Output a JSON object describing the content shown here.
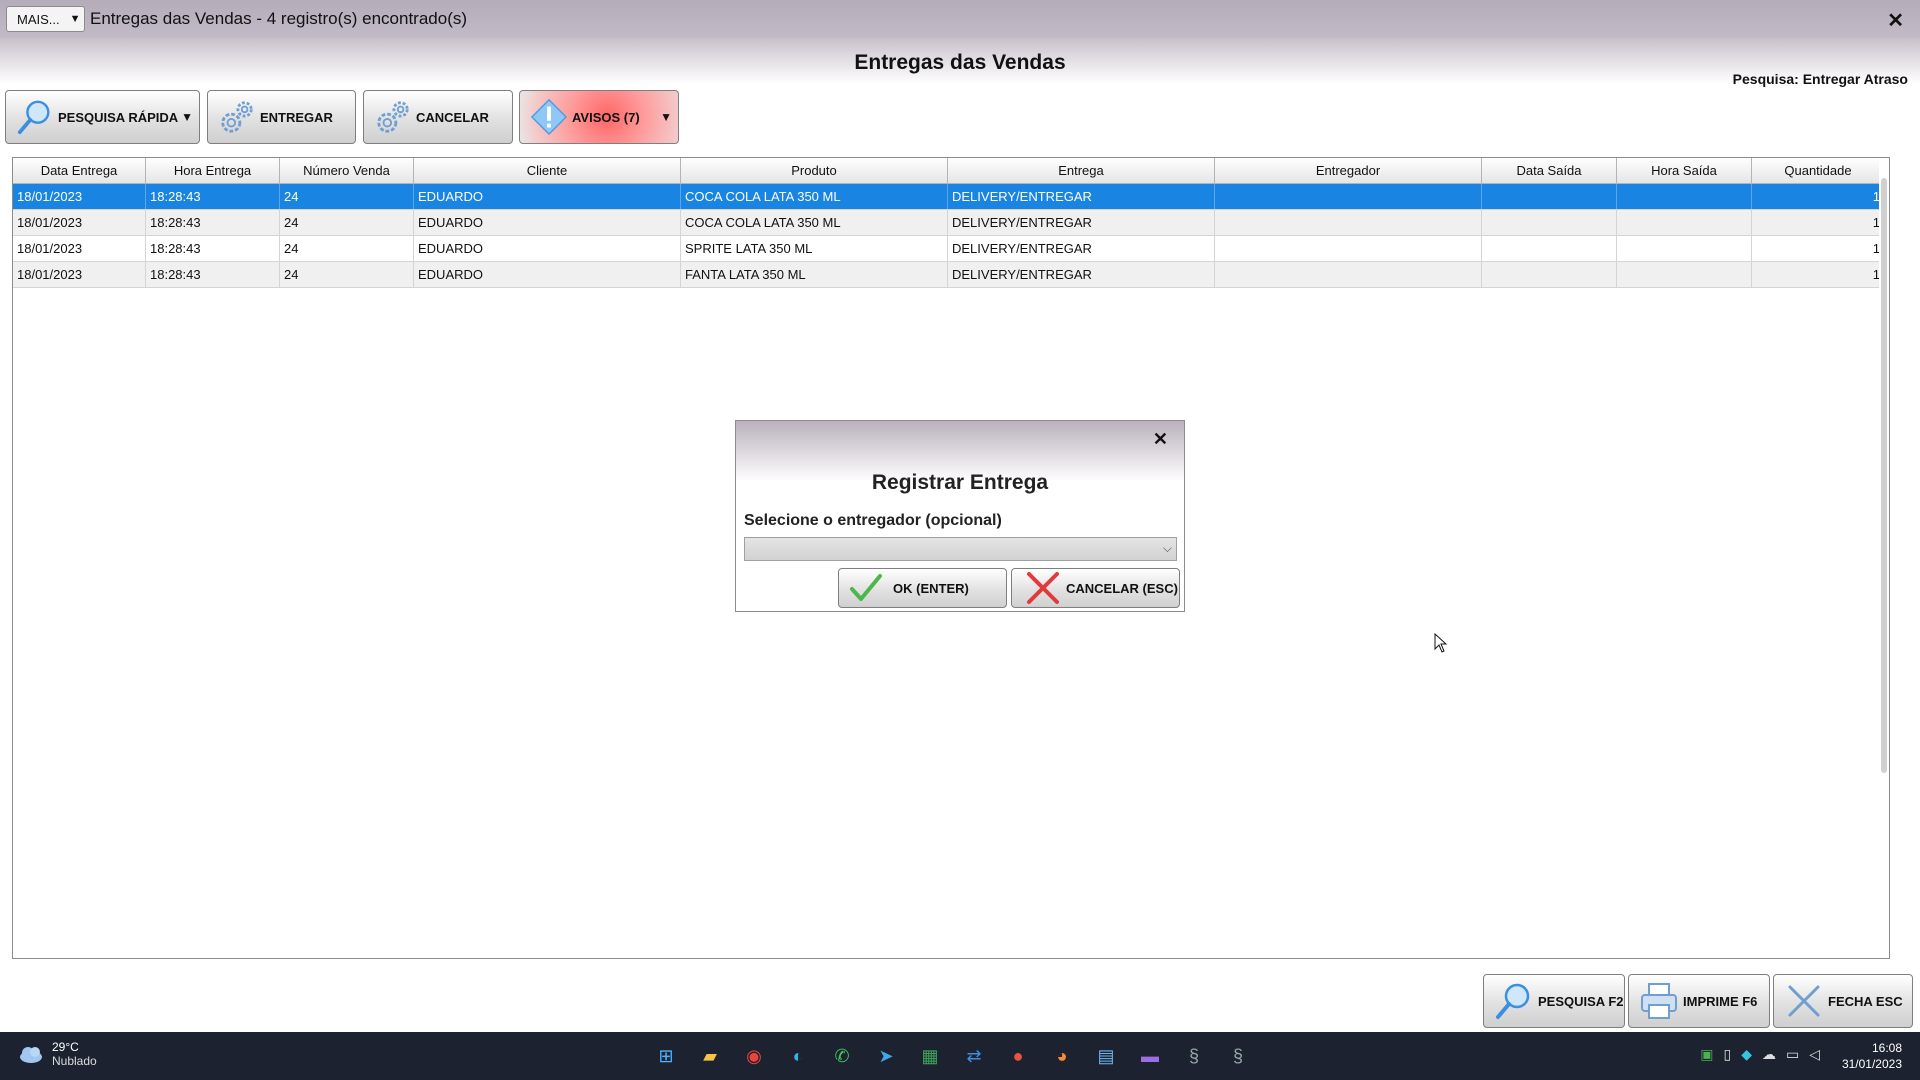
{
  "window": {
    "mais_label": "MAIS...",
    "title": "Entregas das Vendas - 4 registro(s) encontrado(s)",
    "close_glyph": "✕"
  },
  "header": {
    "page_title": "Entregas das Vendas",
    "search_label": "Pesquisa: Entregar Atraso"
  },
  "toolbar": {
    "pesquisa_label": "PESQUISA RÁPIDA",
    "entregar_label": "ENTREGAR",
    "cancelar_label": "CANCELAR",
    "avisos_label": "AVISOS (7)",
    "dropdown_glyph": "▼"
  },
  "grid": {
    "columns": [
      "Data Entrega",
      "Hora Entrega",
      "Número Venda",
      "Cliente",
      "Produto",
      "Entrega",
      "Entregador",
      "Data Saída",
      "Hora Saída",
      "Quantidade"
    ],
    "rows": [
      [
        "18/01/2023",
        "18:28:43",
        "24",
        "EDUARDO",
        "COCA COLA LATA 350 ML",
        "DELIVERY/ENTREGAR",
        "",
        "",
        "",
        "1"
      ],
      [
        "18/01/2023",
        "18:28:43",
        "24",
        "EDUARDO",
        "COCA COLA LATA 350 ML",
        "DELIVERY/ENTREGAR",
        "",
        "",
        "",
        "1"
      ],
      [
        "18/01/2023",
        "18:28:43",
        "24",
        "EDUARDO",
        "SPRITE LATA 350 ML",
        "DELIVERY/ENTREGAR",
        "",
        "",
        "",
        "1"
      ],
      [
        "18/01/2023",
        "18:28:43",
        "24",
        "EDUARDO",
        "FANTA LATA 350 ML",
        "DELIVERY/ENTREGAR",
        "",
        "",
        "",
        "1"
      ]
    ],
    "selected_row": 0
  },
  "dialog": {
    "close_glyph": "✕",
    "title": "Registrar Entrega",
    "label": "Selecione o entregador (opcional)",
    "select_value": "",
    "ok_label": "OK (ENTER)",
    "cancel_label": "CANCELAR (ESC)"
  },
  "bottom": {
    "pesquisa_label": "PESQUISA F2",
    "imprime_label": "IMPRIME F6",
    "fecha_label": "FECHA ESC"
  },
  "taskbar": {
    "temperature": "29°C",
    "condition": "Nublado",
    "time": "16:08",
    "date": "31/01/2023",
    "pinned_icons": [
      "windows-start-icon",
      "file-explorer-icon",
      "chrome-icon",
      "edge-icon",
      "whatsapp-icon",
      "telegram-icon",
      "spreadsheet-icon",
      "remote-icon",
      "app-icon",
      "firefox-icon",
      "notepad-icon",
      "video-editor-icon",
      "system-app-icon",
      "system-app-icon-2"
    ]
  },
  "colors": {
    "selected_row": "#1a84e2",
    "title_bar": "#b5acb9",
    "taskbar": "#1c2230",
    "avisos_accent": "#ff6666"
  }
}
